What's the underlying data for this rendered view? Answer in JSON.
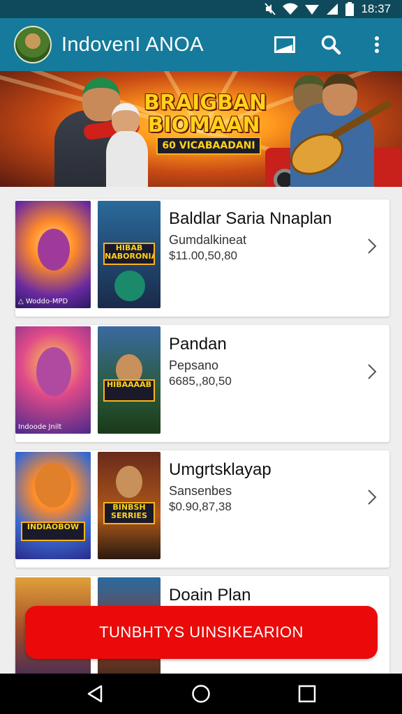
{
  "status_bar": {
    "time": "18:37",
    "icons": [
      "mute-icon",
      "wifi-icon",
      "signal-icon",
      "signal-icon",
      "battery-icon"
    ]
  },
  "app_bar": {
    "title": "IndovenI ANOA",
    "actions": [
      "cast-icon",
      "search-icon",
      "more-vert-icon"
    ]
  },
  "banner": {
    "title": "BRAIGBAN BIOMAAN",
    "subtitle": "60 VICABAADANI"
  },
  "items": [
    {
      "title": "Baldlar Saria Nnaplan",
      "subtitle": "Gumdalkineat",
      "price": "$11.00,50,80",
      "thumb1_caption": "△ Woddo-MPD",
      "thumb2_logo": "HIBAB NABORONIA"
    },
    {
      "title": "Pandan",
      "subtitle": "Pepsano",
      "price": "6685,,80,50",
      "thumb1_caption": "Indoode Jnilt",
      "thumb2_logo": "HIBAAAAB"
    },
    {
      "title": "Umgrtsklayap",
      "subtitle": "Sansenbes",
      "price": "$0.90,87,38",
      "thumb1_caption": "",
      "thumb2_logo": "BINBSH SERRIES",
      "thumb1_logo": "INDIAOBOW"
    },
    {
      "title": "Doain Plan",
      "subtitle": "",
      "price": "",
      "thumb1_caption": "",
      "thumb2_logo": ""
    }
  ],
  "cta": {
    "label": "TUNBHTYS UINSIKEARION"
  },
  "nav_bar": {
    "buttons": [
      "back-icon",
      "home-icon",
      "recents-icon"
    ]
  }
}
